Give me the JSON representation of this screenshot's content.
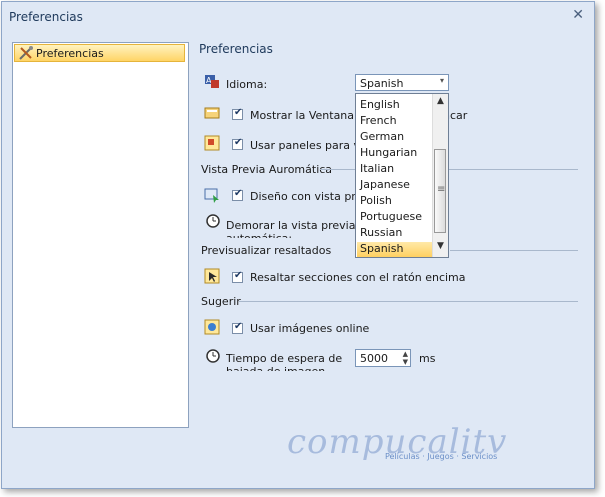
{
  "window": {
    "title": "Preferencias",
    "close_symbol": "✕"
  },
  "nav": {
    "items": [
      {
        "label": "Preferencias",
        "icon": "tools-icon"
      }
    ]
  },
  "main": {
    "header": "Preferencias",
    "language": {
      "label": "Idioma:",
      "selected": "Spanish",
      "arrow": "▾"
    },
    "options": {
      "show_window": "Mostrar la Ventana de Inicio al arrancar",
      "use_panels": "Usar paneles para ver"
    },
    "groups": {
      "auto_preview": {
        "title": "Vista Previa Auromática",
        "design_preview": "Diseño con vista previa",
        "delay_preview": "Demorar la vista previa automática:"
      },
      "highlight": {
        "title": "Previsualizar resaltados",
        "mouse_over": "Resaltar secciones con el ratón encima"
      },
      "suggest": {
        "title": "Sugerir",
        "online_images": "Usar imágenes online",
        "wait_label": "Tiempo de espera de bajada de imagen expirado:",
        "wait_value": "5000",
        "wait_unit": "ms"
      }
    },
    "dropdown": {
      "items": [
        "English",
        "French",
        "German",
        "Hungarian",
        "Italian",
        "Japanese",
        "Polish",
        "Portuguese",
        "Russian",
        "Spanish"
      ],
      "selected_index": 9,
      "scroll_up": "▲",
      "scroll_down": "▼"
    }
  },
  "watermark": {
    "text": "compucalitv",
    "tagline": "Películas · Juegos · Servicios"
  },
  "colors": {
    "accent": "#ffd466",
    "window_bg": "#dfe8f5",
    "border": "#8ea6c8"
  }
}
